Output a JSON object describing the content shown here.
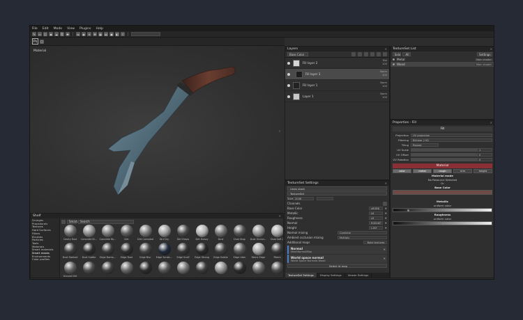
{
  "menu": [
    "File",
    "Edit",
    "Mode",
    "View",
    "Plugins",
    "Help"
  ],
  "toolbar": {
    "ps_label": "Ps"
  },
  "viewport": {
    "label": "Material"
  },
  "layers": {
    "title": "Layers",
    "channel_select": "Base Color",
    "items": [
      {
        "name": "Fill layer 2",
        "blend": "Mul",
        "opacity": "100",
        "thumb": "#d6d6d6"
      },
      {
        "name": "Fill layer 3",
        "blend": "Norm",
        "opacity": "100",
        "thumb": "#1e1e1e"
      },
      {
        "name": "Fill layer 1",
        "blend": "Norm",
        "opacity": "100",
        "thumb": "#222222"
      },
      {
        "name": "Layer 1",
        "blend": "Norm",
        "opacity": "100",
        "thumb": "#c8c8c8"
      }
    ]
  },
  "texture_set_settings": {
    "title": "TextureSet Settings",
    "undo_stack": "Undo stack",
    "textureset": "TextureSet",
    "size_label": "Size",
    "size_value": "2048",
    "channels_label": "Channels",
    "channels": [
      {
        "name": "Base Color",
        "value": "sRGB8"
      },
      {
        "name": "Metallic",
        "value": "L8"
      },
      {
        "name": "Roughness",
        "value": "L8"
      },
      {
        "name": "Normal",
        "value": "RGB16F"
      },
      {
        "name": "Height",
        "value": "L16F"
      }
    ],
    "normal_mixing_label": "Normal mixing",
    "normal_mixing_value": "Combine",
    "ambient_label": "Ambient occlusion mixing",
    "ambient_value": "Multiply",
    "additional_maps_label": "Additional maps",
    "bake_button": "Bake textures",
    "maps": [
      {
        "title": "Normal",
        "sub": "MeshNormalMap"
      },
      {
        "title": "World space normal",
        "sub": "World Space Normals Wood"
      }
    ],
    "select_map": "Select id map",
    "tabs": [
      "TextureSet Settings",
      "Display Settings",
      "Viewer Settings"
    ]
  },
  "texture_set_list": {
    "title": "TextureSet List",
    "solo": "Solo",
    "all": "All",
    "settings": "Settings",
    "items": [
      {
        "name": "Metal",
        "shader": "Main shader"
      },
      {
        "name": "Wood",
        "shader": "Main shader"
      }
    ]
  },
  "properties": {
    "title": "Properties - Fill",
    "fill": "Fill",
    "rows": [
      {
        "label": "Projection",
        "value": "UV projection"
      },
      {
        "label": "Filtering",
        "value": "Bilinear | HQ"
      },
      {
        "label": "Tiling",
        "value": "Repeat"
      },
      {
        "label": "UV Scale",
        "value": "1"
      },
      {
        "label": "UV Offset",
        "value": "0"
      },
      {
        "label": "UV Rotation",
        "value": "0"
      }
    ],
    "material_header": "Material",
    "channels": [
      "color",
      "metal",
      "rough",
      "nrm",
      "height"
    ],
    "material_mode": "Material mode",
    "no_resource": "No Resource Selected",
    "or": "Or",
    "base_color": "Base Color",
    "metallic": "Metallic",
    "metallic_sub": "uniform color",
    "roughness": "Roughness",
    "roughness_sub": "uniform color"
  },
  "shelf": {
    "title": "Shelf",
    "categories": [
      "Grunges",
      "Procedurals",
      "Textures",
      "Hard Surfaces",
      "Filters",
      "Brushes",
      "Particles",
      "Tools",
      "Materials",
      "Smart materials",
      "Smart masks",
      "Environments",
      "Color profiles"
    ],
    "search_value": "Search",
    "filter_tag": "Smart...",
    "items": [
      {
        "name": "Cavity Rust",
        "c": "#6a6a6a"
      },
      {
        "name": "Concrete Bl...",
        "c": "#8a8a8a"
      },
      {
        "name": "Concrete Ro...",
        "c": "#7a7a7a"
      },
      {
        "name": "Dirt",
        "c": "#5c5c5c"
      },
      {
        "name": "Dirt Corroded",
        "c": "#777"
      },
      {
        "name": "Dirt Dry",
        "c": "#9a9a9a"
      },
      {
        "name": "Dirt Drops",
        "c": "#4a4a4a"
      },
      {
        "name": "Dirt Heavy",
        "c": "#b0b0b0"
      },
      {
        "name": "Dust",
        "c": "#6f6f6f"
      },
      {
        "name": "Dust Stop",
        "c": "#525252"
      },
      {
        "name": "Dust Occlus...",
        "c": "#8c8c8c"
      },
      {
        "name": "Dust Soft 2",
        "c": "#a6a6a6"
      },
      {
        "name": "Dust Stained",
        "c": "#3d3d3d"
      },
      {
        "name": "Dust Subtle",
        "c": "#2e2e2e"
      },
      {
        "name": "Edge Dama...",
        "c": "#3a3a3a"
      },
      {
        "name": "Edge Rust",
        "c": "#2f2f2f"
      },
      {
        "name": "Edge Blur",
        "c": "#444"
      },
      {
        "name": "Edge Scratc...",
        "c": "#1f2a3a"
      },
      {
        "name": "Edge Scuff",
        "c": "#363636"
      },
      {
        "name": "Edge Strong",
        "c": "#2a2a2a"
      },
      {
        "name": "Edge Subtle",
        "c": "#3f3f3f"
      },
      {
        "name": "Edge Uber",
        "c": "#555"
      },
      {
        "name": "Fabric Edge",
        "c": "#9e9e9e"
      },
      {
        "name": "Fibers",
        "c": "#3a3a3a"
      },
      {
        "name": "Ground Dirt",
        "c": "#5e5e5e"
      },
      {
        "name": "",
        "c": "#4d4d4d"
      },
      {
        "name": "",
        "c": "#3f3f3f"
      },
      {
        "name": "",
        "c": "#676767"
      },
      {
        "name": "",
        "c": "#2d2d2d"
      },
      {
        "name": "",
        "c": "#555"
      },
      {
        "name": "",
        "c": "#707070"
      },
      {
        "name": "",
        "c": "#3c3c3c"
      },
      {
        "name": "",
        "c": "#8f8f8f"
      },
      {
        "name": "",
        "c": "#2c2c2c"
      },
      {
        "name": "",
        "c": "#666"
      },
      {
        "name": "",
        "c": "#4a4a4a"
      }
    ]
  }
}
